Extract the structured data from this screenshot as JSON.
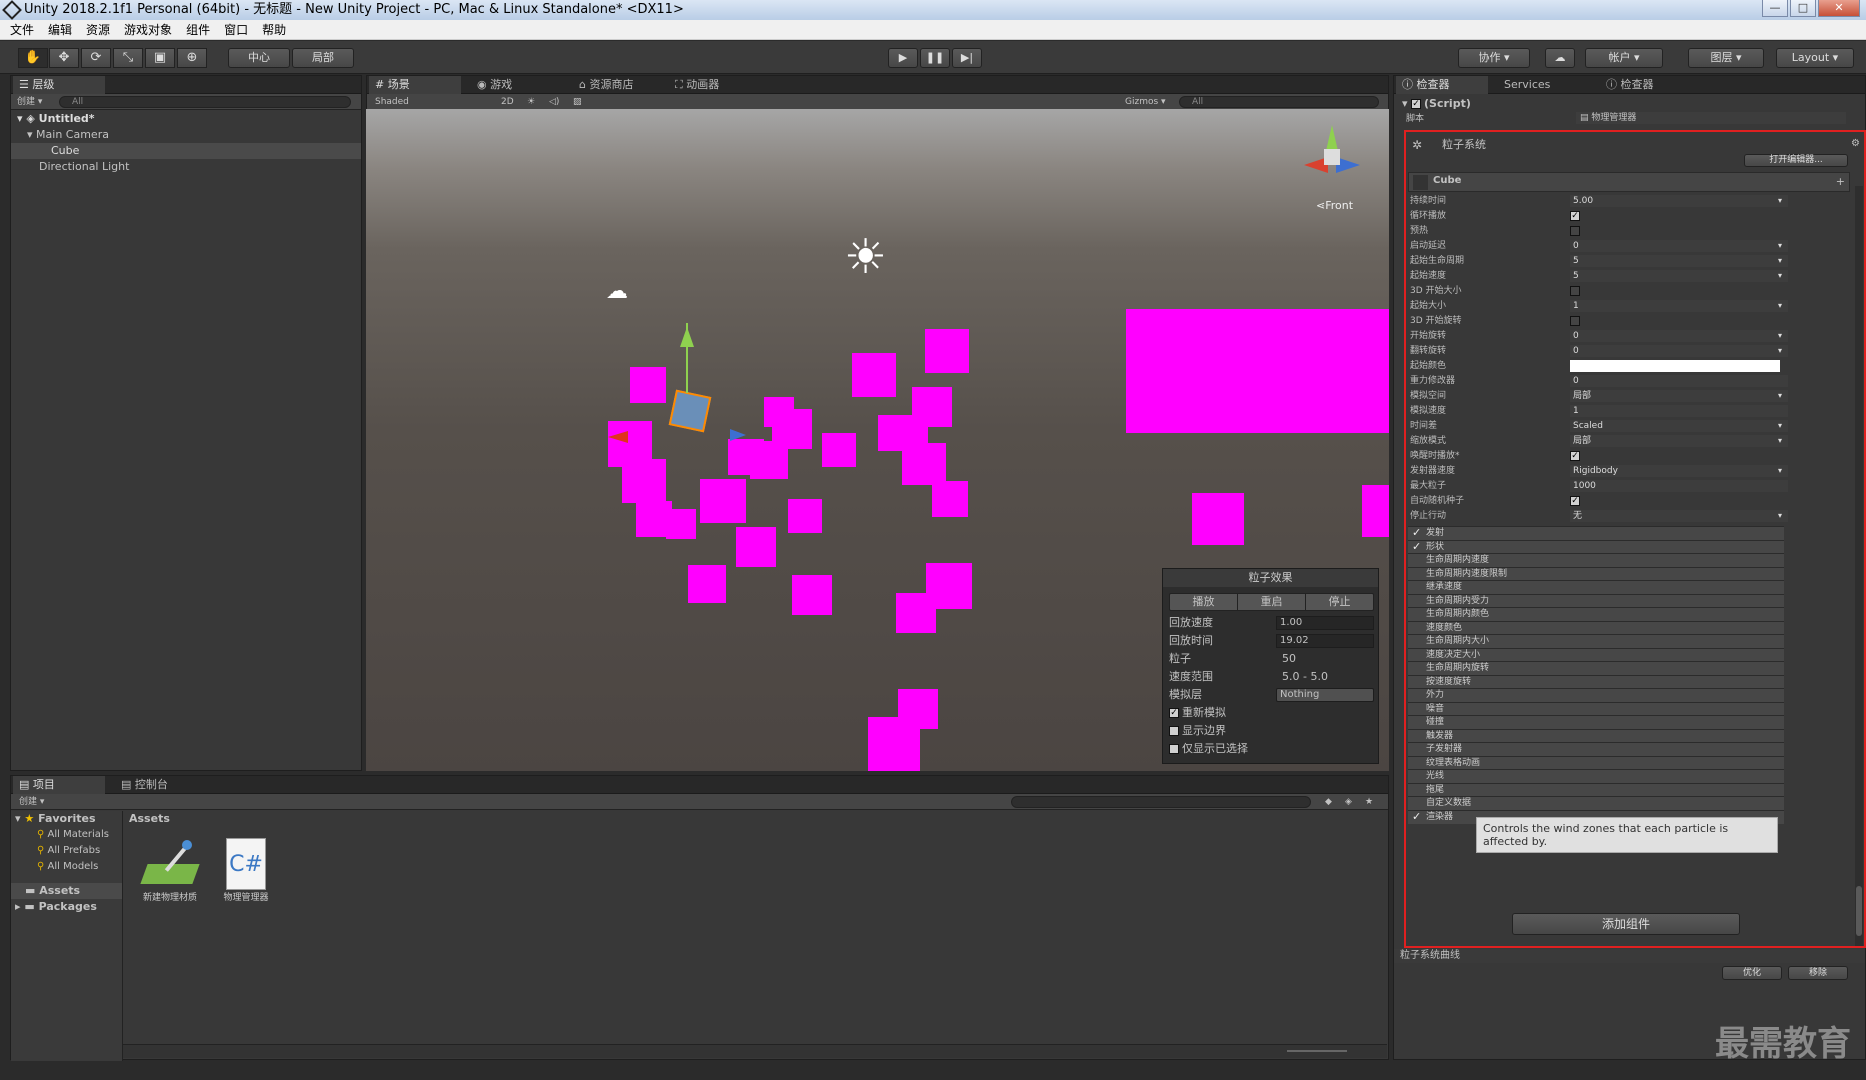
{
  "window": {
    "title": "Unity 2018.2.1f1 Personal (64bit) - 无标题 - New Unity Project - PC, Mac & Linux Standalone* <DX11>",
    "minimize": "—",
    "maximize": "□",
    "close": "✕"
  },
  "menu": [
    "文件",
    "编辑",
    "资源",
    "游戏对象",
    "组件",
    "窗口",
    "帮助"
  ],
  "toolbar": {
    "pivot": "中心",
    "space": "局部",
    "collab": "协作",
    "account": "帐户",
    "layers": "图层",
    "layout": "Layout"
  },
  "hierarchy": {
    "tab": "层级",
    "create": "创建 ▾",
    "search": "All",
    "scene": "Untitled*",
    "items": [
      "Main Camera",
      "Cube",
      "Directional Light"
    ]
  },
  "scene_tabs": [
    "场景",
    "游戏",
    "资源商店",
    "动画器"
  ],
  "scene_bar": {
    "mode": "Shaded",
    "twod": "2D",
    "gizmos": "Gizmos ▾",
    "search": "All"
  },
  "gizmo_label": "Front",
  "particle_effect": {
    "title": "粒子效果",
    "buttons": [
      "播放",
      "重启",
      "停止"
    ],
    "rows": [
      {
        "label": "回放速度",
        "value": "1.00"
      },
      {
        "label": "回放时间",
        "value": "19.02"
      },
      {
        "label": "粒子",
        "value": "50"
      },
      {
        "label": "速度范围",
        "value": "5.0 - 5.0"
      },
      {
        "label": "模拟层",
        "value": "Nothing"
      }
    ],
    "checks": [
      {
        "label": "重新模拟",
        "checked": true
      },
      {
        "label": "显示边界",
        "checked": false
      },
      {
        "label": "仅显示已选择",
        "checked": false
      }
    ]
  },
  "project": {
    "tabs": [
      "项目",
      "控制台"
    ],
    "create": "创建 ▾",
    "favorites": "Favorites",
    "fav_items": [
      "All Materials",
      "All Prefabs",
      "All Models"
    ],
    "folders": [
      "Assets",
      "Packages"
    ],
    "assets_header": "Assets",
    "assets": [
      "新建物理材质",
      "物理管理器"
    ]
  },
  "inspector": {
    "tabs": [
      "检查器",
      "Services",
      "检查器"
    ],
    "script_header": "(Script)",
    "script_label": "脚本",
    "script_value": "物理管理器",
    "component": "粒子系统",
    "open_editor": "打开编辑器...",
    "system_name": "Cube",
    "props": [
      {
        "k": "持续时间",
        "v": "5.00"
      },
      {
        "k": "循环播放",
        "v": "✓",
        "check": true
      },
      {
        "k": "预热",
        "v": "",
        "check": true
      },
      {
        "k": "启动延迟",
        "v": "0"
      },
      {
        "k": "起始生命周期",
        "v": "5"
      },
      {
        "k": "起始速度",
        "v": "5"
      },
      {
        "k": "3D 开始大小",
        "v": "",
        "check": true
      },
      {
        "k": "起始大小",
        "v": "1"
      },
      {
        "k": "3D 开始旋转",
        "v": "",
        "check": true
      },
      {
        "k": "开始旋转",
        "v": "0"
      },
      {
        "k": "翻转旋转",
        "v": "0"
      },
      {
        "k": "起始颜色",
        "v": "",
        "color": true
      },
      {
        "k": "重力修改器",
        "v": "0"
      },
      {
        "k": "模拟空间",
        "v": "局部"
      },
      {
        "k": "模拟速度",
        "v": "1"
      },
      {
        "k": "时间差",
        "v": "Scaled"
      },
      {
        "k": "缩放模式",
        "v": "局部"
      },
      {
        "k": "唤醒时播放*",
        "v": "✓",
        "check": true
      },
      {
        "k": "发射器速度",
        "v": "Rigidbody"
      },
      {
        "k": "最大粒子",
        "v": "1000"
      },
      {
        "k": "自动随机种子",
        "v": "✓",
        "check": true
      },
      {
        "k": "停止行动",
        "v": "无"
      }
    ],
    "modules": [
      {
        "name": "发射",
        "on": true
      },
      {
        "name": "形状",
        "on": true
      },
      {
        "name": "生命周期内速度",
        "on": false
      },
      {
        "name": "生命周期内速度限制",
        "on": false
      },
      {
        "name": "继承速度",
        "on": false
      },
      {
        "name": "生命周期内受力",
        "on": false
      },
      {
        "name": "生命周期内颜色",
        "on": false
      },
      {
        "name": "速度颜色",
        "on": false
      },
      {
        "name": "生命周期内大小",
        "on": false
      },
      {
        "name": "速度决定大小",
        "on": false
      },
      {
        "name": "生命周期内旋转",
        "on": false
      },
      {
        "name": "按速度旋转",
        "on": false
      },
      {
        "name": "外力",
        "on": false
      },
      {
        "name": "噪音",
        "on": false
      },
      {
        "name": "碰撞",
        "on": false
      },
      {
        "name": "触发器",
        "on": false
      },
      {
        "name": "子发射器",
        "on": false
      },
      {
        "name": "纹理表格动画",
        "on": false
      },
      {
        "name": "光线",
        "on": false
      },
      {
        "name": "拖尾",
        "on": false
      },
      {
        "name": "自定义数据",
        "on": false
      },
      {
        "name": "渲染器",
        "on": true
      }
    ],
    "tooltip": "Controls the wind zones that each particle is affected by.",
    "add_component": "添加组件",
    "curves_title": "粒子系统曲线",
    "curves_buttons": [
      "优化",
      "移除"
    ]
  },
  "watermark": "最需教育",
  "colors": {
    "accent": "#ff00ff",
    "highlight": "#e02020"
  }
}
